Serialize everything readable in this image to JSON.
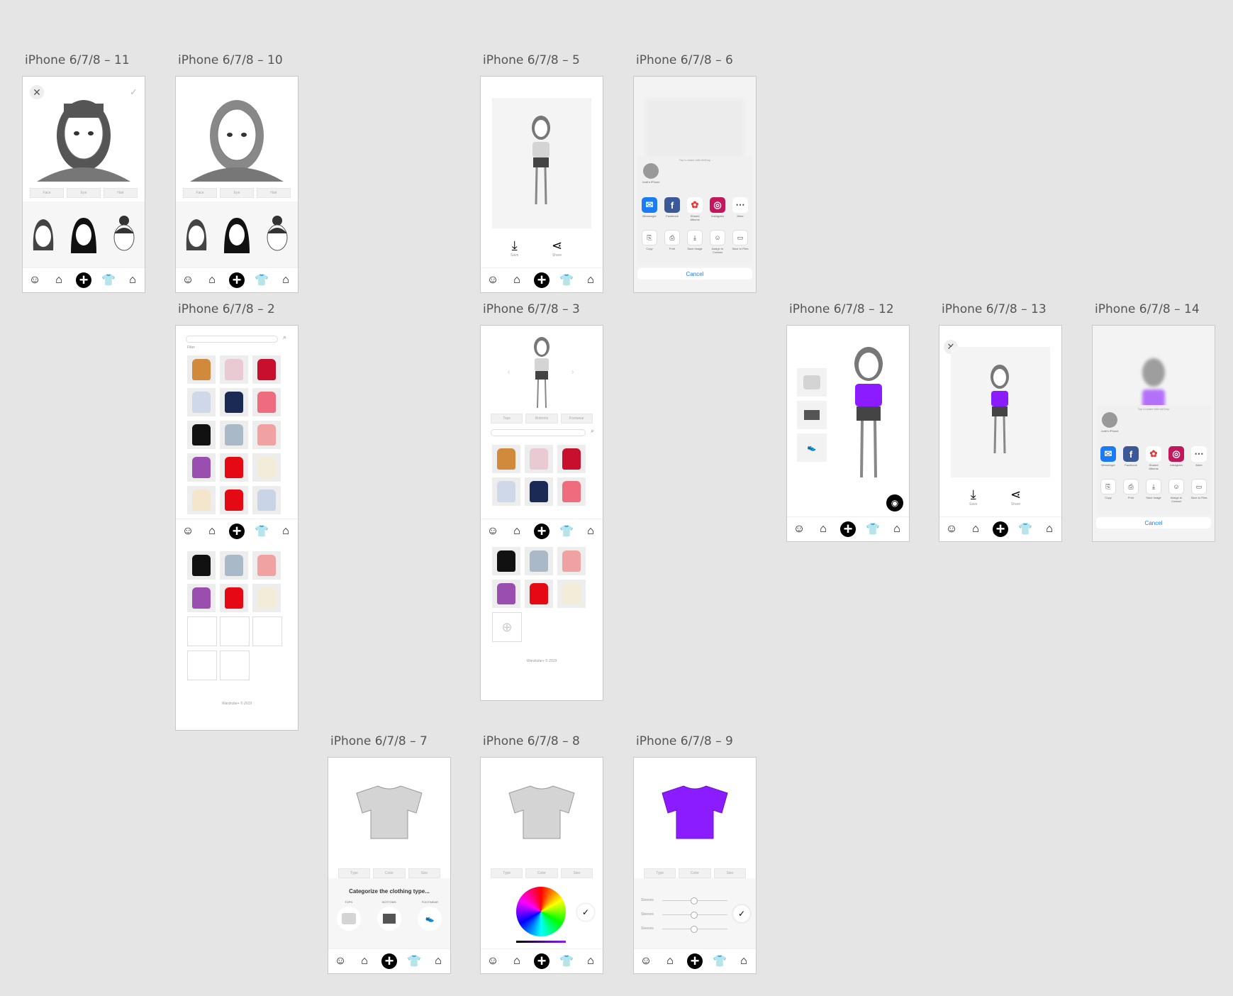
{
  "artboards": {
    "a11": "iPhone 6/7/8 – 11",
    "a10": "iPhone 6/7/8 – 10",
    "a5": "iPhone 6/7/8 – 5",
    "a6": "iPhone 6/7/8 – 6",
    "a2": "iPhone 6/7/8 – 2",
    "a3": "iPhone 6/7/8 – 3",
    "a12": "iPhone 6/7/8 – 12",
    "a13": "iPhone 6/7/8 – 13",
    "a14": "iPhone 6/7/8 – 14",
    "a7": "iPhone 6/7/8 – 7",
    "a8": "iPhone 6/7/8 – 8",
    "a9": "iPhone 6/7/8 – 9"
  },
  "face_editor": {
    "tabs": [
      "Face",
      "Eye",
      "Hair"
    ]
  },
  "actions": {
    "save": "Save",
    "share": "Share"
  },
  "share_sheet": {
    "airdrop_hint": "Tap to share with AirDrop",
    "contact": "Jordi's iPhone",
    "apps": [
      "Messenger",
      "Facebook",
      "Shared Albums",
      "Instagram",
      "More"
    ],
    "actions": [
      "Copy",
      "Print",
      "Save Image",
      "Assign to Contact",
      "Save to Files"
    ],
    "cancel": "Cancel"
  },
  "closet": {
    "filter_label": "Filter",
    "footer": "Wardrobe+ © 2019",
    "tabs": [
      "Tops",
      "Bottoms",
      "Footwear"
    ]
  },
  "add_item": {
    "tabs": [
      "Type",
      "Color",
      "Size"
    ],
    "categorize_title": "Categorize the clothing type...",
    "categories": [
      "TOPS",
      "BOTTOMS",
      "FOOTWEAR"
    ],
    "slider_labels": [
      "Sleeves",
      "Sleeves",
      "Sleeves"
    ]
  },
  "colors": {
    "purple": "#8a1cff",
    "grey_tee": "#d4d4d4",
    "accent_blue": "#1a7cf5"
  },
  "tabbar_icons": [
    "smiley-icon",
    "hanger-icon",
    "plus-icon",
    "shirt-icon",
    "home-icon"
  ]
}
